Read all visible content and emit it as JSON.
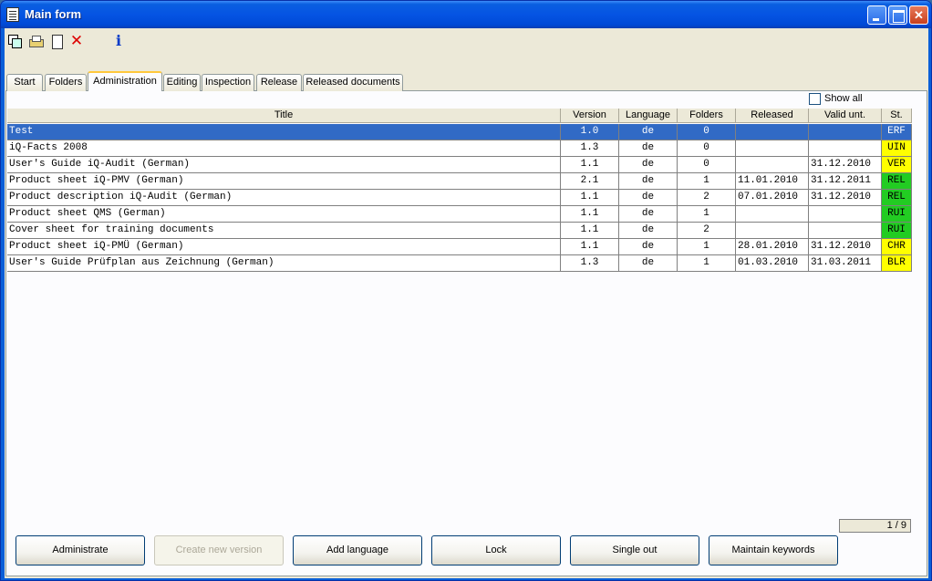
{
  "window": {
    "title": "Main form"
  },
  "colors": {
    "selected_row": "#316ac5",
    "status_green": "#22cc22",
    "status_yellow": "#ffff00",
    "status_blue": "#316ac5"
  },
  "toolbar": {
    "icons": [
      "copy-icon",
      "print-icon",
      "new-document-icon",
      "delete-icon",
      "info-icon"
    ],
    "delete_glyph": "✕",
    "info_glyph": "i"
  },
  "tabs": [
    "Start",
    "Folders",
    "Administration",
    "Editing",
    "Inspection",
    "Release",
    "Released documents"
  ],
  "active_tab": "Administration",
  "show_all": {
    "label": "Show all",
    "checked": false
  },
  "grid": {
    "columns": [
      "Title",
      "Version",
      "Language",
      "Folders",
      "Released",
      "Valid unt.",
      "St."
    ],
    "rows": [
      {
        "title": "Test",
        "version": "1.0",
        "language": "de",
        "folders": "0",
        "released": "",
        "valid": "",
        "status": "ERF",
        "status_color": "blue",
        "selected": true
      },
      {
        "title": "iQ-Facts 2008",
        "version": "1.3",
        "language": "de",
        "folders": "0",
        "released": "",
        "valid": "",
        "status": "UIN",
        "status_color": "yellow"
      },
      {
        "title": "User's Guide iQ-Audit (German)",
        "version": "1.1",
        "language": "de",
        "folders": "0",
        "released": "",
        "valid": "31.12.2010",
        "status": "VER",
        "status_color": "yellow"
      },
      {
        "title": "Product sheet iQ-PMV (German)",
        "version": "2.1",
        "language": "de",
        "folders": "1",
        "released": "11.01.2010",
        "valid": "31.12.2011",
        "status": "REL",
        "status_color": "green"
      },
      {
        "title": "Product description iQ-Audit (German)",
        "version": "1.1",
        "language": "de",
        "folders": "2",
        "released": "07.01.2010",
        "valid": "31.12.2010",
        "status": "REL",
        "status_color": "green"
      },
      {
        "title": "Product sheet QMS (German)",
        "version": "1.1",
        "language": "de",
        "folders": "1",
        "released": "",
        "valid": "",
        "status": "RUI",
        "status_color": "green"
      },
      {
        "title": "Cover sheet for training documents",
        "version": "1.1",
        "language": "de",
        "folders": "2",
        "released": "",
        "valid": "",
        "status": "RUI",
        "status_color": "green"
      },
      {
        "title": "Product sheet iQ-PMÜ (German)",
        "version": "1.1",
        "language": "de",
        "folders": "1",
        "released": "28.01.2010",
        "valid": "31.12.2010",
        "status": "CHR",
        "status_color": "yellow"
      },
      {
        "title": "User's Guide Prüfplan aus Zeichnung (German)",
        "version": "1.3",
        "language": "de",
        "folders": "1",
        "released": "01.03.2010",
        "valid": "31.03.2011",
        "status": "BLR",
        "status_color": "yellow"
      }
    ]
  },
  "counter": "1 / 9",
  "buttons": [
    {
      "label": "Administrate",
      "enabled": true
    },
    {
      "label": "Create new version",
      "enabled": false
    },
    {
      "label": "Add language",
      "enabled": true
    },
    {
      "label": "Lock",
      "enabled": true
    },
    {
      "label": "Single out",
      "enabled": true
    },
    {
      "label": "Maintain keywords",
      "enabled": true
    }
  ]
}
